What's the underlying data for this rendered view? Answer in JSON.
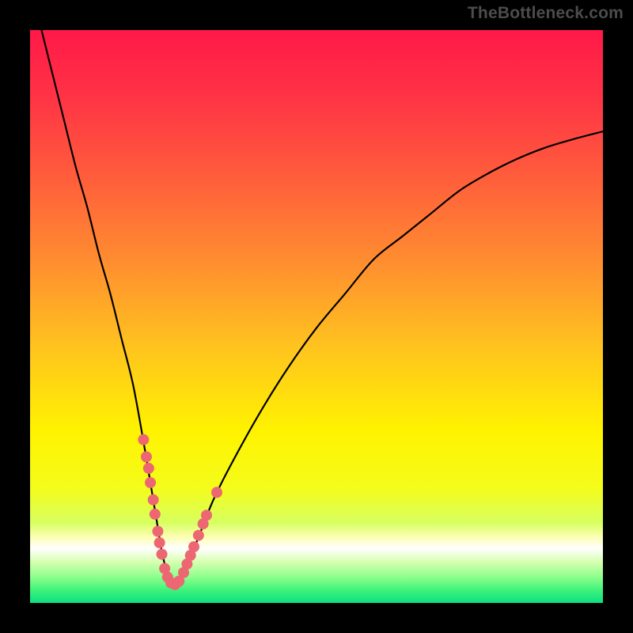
{
  "watermark": {
    "text": "TheBottleneck.com"
  },
  "colors": {
    "frame": "#000000",
    "curve": "#000000",
    "marker": "#ed6773",
    "gradient_stops": [
      {
        "offset": 0.0,
        "color": "#ff1948"
      },
      {
        "offset": 0.12,
        "color": "#ff3445"
      },
      {
        "offset": 0.25,
        "color": "#ff5b3c"
      },
      {
        "offset": 0.4,
        "color": "#ff8c30"
      },
      {
        "offset": 0.55,
        "color": "#ffc21f"
      },
      {
        "offset": 0.7,
        "color": "#fff300"
      },
      {
        "offset": 0.8,
        "color": "#f4fc1b"
      },
      {
        "offset": 0.86,
        "color": "#d7ff60"
      },
      {
        "offset": 0.885,
        "color": "#fdffb4"
      },
      {
        "offset": 0.905,
        "color": "#ffffff"
      },
      {
        "offset": 0.928,
        "color": "#d7ffb0"
      },
      {
        "offset": 0.955,
        "color": "#8cff8c"
      },
      {
        "offset": 0.978,
        "color": "#3df27a"
      },
      {
        "offset": 1.0,
        "color": "#0be083"
      }
    ]
  },
  "chart_data": {
    "type": "line",
    "title": "",
    "xlabel": "",
    "ylabel": "",
    "xlim": [
      0,
      100
    ],
    "ylim": [
      0,
      100
    ],
    "series": [
      {
        "name": "bottleneck-curve",
        "x": [
          2,
          4,
          6,
          8,
          10,
          12,
          14,
          16,
          18,
          20,
          21,
          22,
          23,
          24,
          25,
          26,
          28,
          30,
          32,
          35,
          40,
          45,
          50,
          55,
          60,
          65,
          70,
          75,
          80,
          85,
          90,
          95,
          100
        ],
        "y": [
          100,
          92,
          84,
          76,
          69,
          61,
          54,
          46,
          38,
          27,
          21,
          15,
          9,
          5,
          3,
          4,
          8,
          13,
          18,
          24,
          33,
          41,
          48,
          54,
          60,
          64,
          68,
          72,
          75,
          77.5,
          79.5,
          81,
          82.3
        ]
      }
    ],
    "markers": {
      "name": "highlight-points",
      "x": [
        19.8,
        20.3,
        20.7,
        21.0,
        21.5,
        21.8,
        22.3,
        22.6,
        23.0,
        23.5,
        24.0,
        24.6,
        25.3,
        26.0,
        26.8,
        27.4,
        28.0,
        28.6,
        29.4,
        30.2,
        30.8,
        32.6
      ],
      "y": [
        28.5,
        25.5,
        23.5,
        21.0,
        18.0,
        15.5,
        12.5,
        10.5,
        8.5,
        6.0,
        4.5,
        3.5,
        3.2,
        3.8,
        5.3,
        6.8,
        8.3,
        9.8,
        11.8,
        13.8,
        15.3,
        19.3
      ]
    }
  }
}
